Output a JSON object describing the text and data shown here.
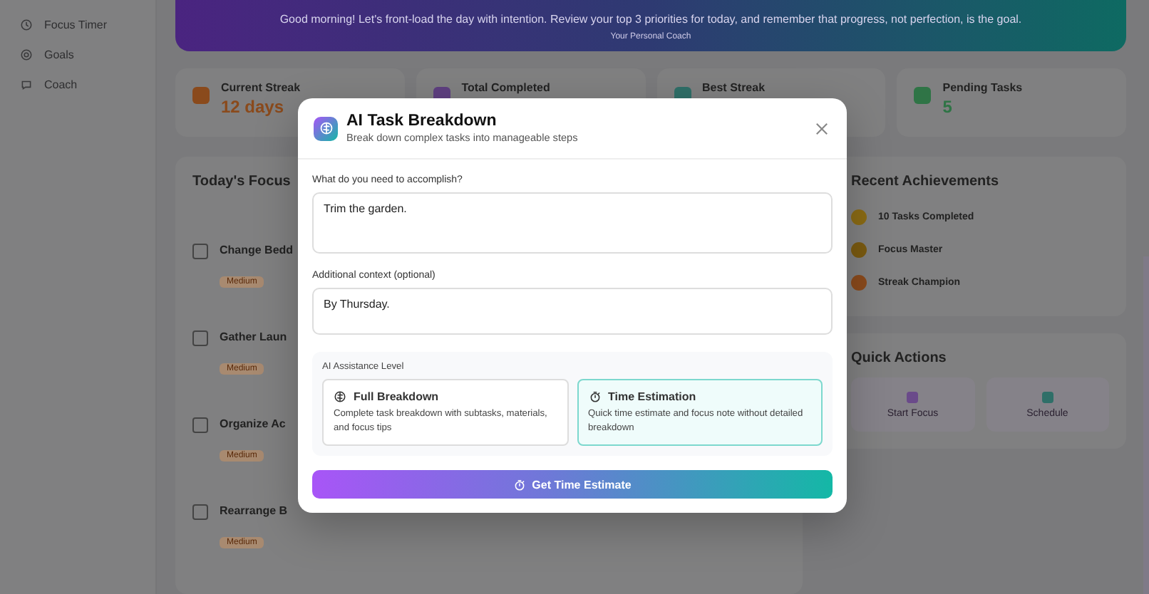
{
  "sidebar": {
    "items": [
      {
        "label": "Focus Timer"
      },
      {
        "label": "Goals"
      },
      {
        "label": "Coach"
      }
    ]
  },
  "banner": {
    "text": "Good morning! Let's front-load the day with intention. Review your top 3 priorities for today, and remember that progress, not perfection, is the goal.",
    "link": "Your Personal Coach"
  },
  "stats": [
    {
      "label": "Current Streak",
      "value": "12 days",
      "color": "#8a4a1c"
    },
    {
      "label": "Total Completed",
      "color": "#5e3f80"
    },
    {
      "label": "Best Streak",
      "color": "#2f6f68"
    },
    {
      "label": "Pending Tasks",
      "value": "5",
      "color": "#2f7446"
    }
  ],
  "focus": {
    "title": "Today's Focus",
    "tasks": [
      {
        "title": "Change Bedd",
        "badge": "Medium",
        "checked": false
      },
      {
        "title": "Gather Laun",
        "badge": "Medium",
        "checked": false
      },
      {
        "title": "Organize Ac",
        "badge": "Medium",
        "checked": false
      },
      {
        "title": "Rearrange B",
        "badge": "Medium",
        "checked": false
      }
    ]
  },
  "achievements": {
    "title": "Recent Achievements",
    "items": [
      {
        "title": "10 Tasks Completed",
        "color": "#8a6a14"
      },
      {
        "title": "Focus Master",
        "color": "#7a5a10"
      },
      {
        "title": "Streak Champion",
        "color": "#8a4a1c"
      }
    ]
  },
  "quick_actions": {
    "title": "Quick Actions",
    "items": [
      {
        "label": "Start Focus",
        "color": "#6a4a8a"
      },
      {
        "label": "Schedule",
        "color": "#2f6f68"
      }
    ]
  },
  "modal": {
    "title": "AI Task Breakdown",
    "subtitle": "Break down complex tasks into manageable steps",
    "fields": [
      {
        "label": "What do you need to accomplish?",
        "value": "Trim the garden."
      },
      {
        "label": "Additional context (optional)",
        "value": "By Thursday."
      }
    ],
    "assistance": {
      "label": "AI Assistance Level",
      "options": [
        {
          "title": "Full Breakdown",
          "description": "Complete task breakdown with subtasks, materials, and focus tips",
          "selected": false
        },
        {
          "title": "Time Estimation",
          "description": "Quick time estimate and focus note without detailed breakdown",
          "selected": true
        }
      ]
    },
    "submit": "Get Time Estimate"
  }
}
